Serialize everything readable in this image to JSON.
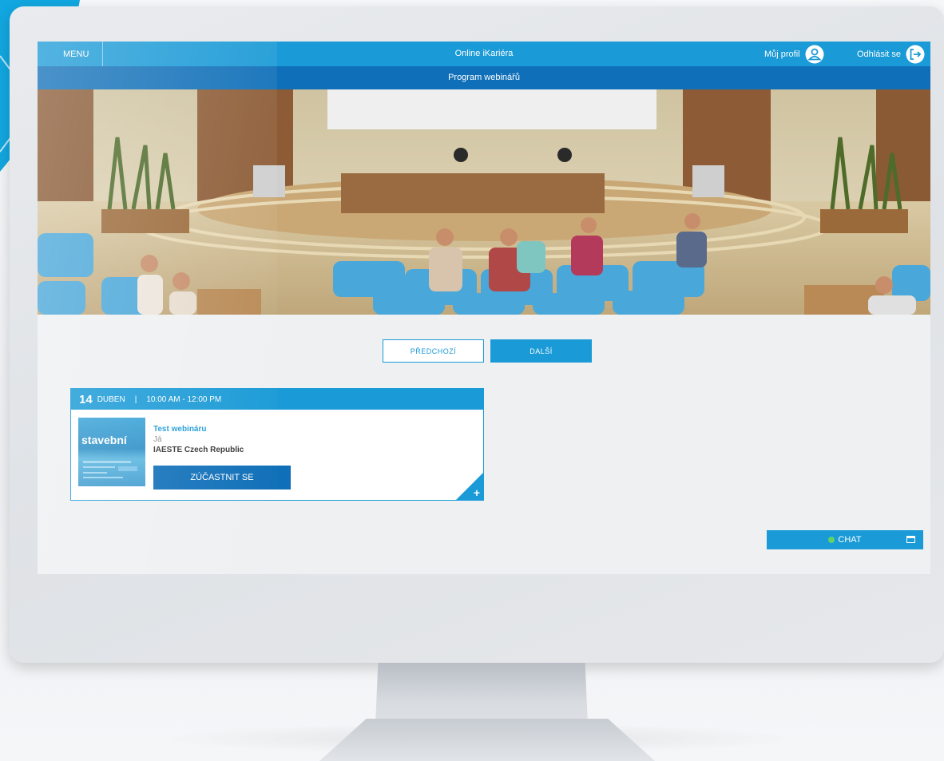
{
  "header": {
    "menu_label": "MENU",
    "app_title": "Online iKariéra",
    "profile_label": "Můj profil",
    "logout_label": "Odhlásit se",
    "profile_icon": "user-icon",
    "logout_icon": "logout-arrow-icon"
  },
  "subheader": {
    "title": "Program webinářů"
  },
  "pager": {
    "prev_label": "PŘEDCHOZÍ",
    "next_label": "DALŠÍ"
  },
  "event": {
    "day": "14",
    "month": "DUBEN",
    "separator": "|",
    "time_range": "10:00 AM - 12:00 PM",
    "thumbnail_text": "stavební",
    "title": "Test webináru",
    "speaker": "Já",
    "organization": "IAESTE Czech Republic",
    "join_label": "ZÚČASTNIT SE",
    "expand_icon": "plus-icon"
  },
  "chat": {
    "label": "CHAT",
    "status_icon": "online-dot-icon",
    "window_icon": "window-icon"
  },
  "colors": {
    "primary": "#1a9ad6",
    "primary_dark": "#0f6fb8",
    "online": "#5fd36a"
  }
}
